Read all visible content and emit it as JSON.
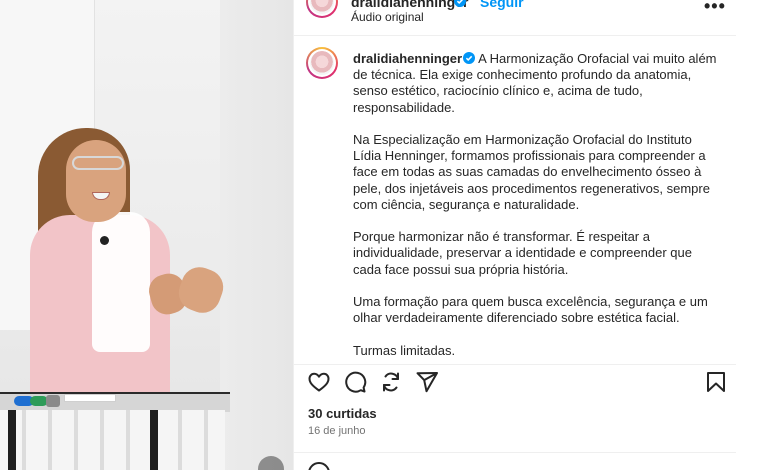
{
  "header": {
    "username": "dralidiahenninger",
    "follow_label": "Seguir",
    "audio": "Áudio original",
    "more_label": "•••"
  },
  "caption": {
    "username": "dralidiahenninger",
    "p1": "A Harmonização Orofacial vai muito além de técnica. Ela exige conhecimento profundo da anatomia, senso estético, raciocínio clínico e, acima de tudo, responsabilidade.",
    "p2": "Na Especialização em Harmonização Orofacial do Instituto Lídia Henninger, formamos profissionais para compreender a face em todas as suas camadas do envelhecimento ósseo à pele, dos injetáveis aos procedimentos regenerativos, sempre com ciência, segurança e naturalidade.",
    "p3": "Porque harmonizar não é transformar. É respeitar a individualidade, preservar a identidade e compreender que cada face possui sua própria história.",
    "p4": "Uma formação para quem busca excelência, segurança e um olhar verdadeiramente diferenciado sobre estética facial.",
    "p5": "Turmas limitadas."
  },
  "actions": {
    "icons": [
      "heart-icon",
      "comment-icon",
      "repost-icon",
      "share-icon",
      "save-icon"
    ]
  },
  "stats": {
    "likes": "30 curtidas",
    "date": "16 de junho"
  },
  "colors": {
    "link_blue": "#0095f6",
    "verified_blue": "#0095f6",
    "text": "#262626",
    "muted": "#737373"
  }
}
